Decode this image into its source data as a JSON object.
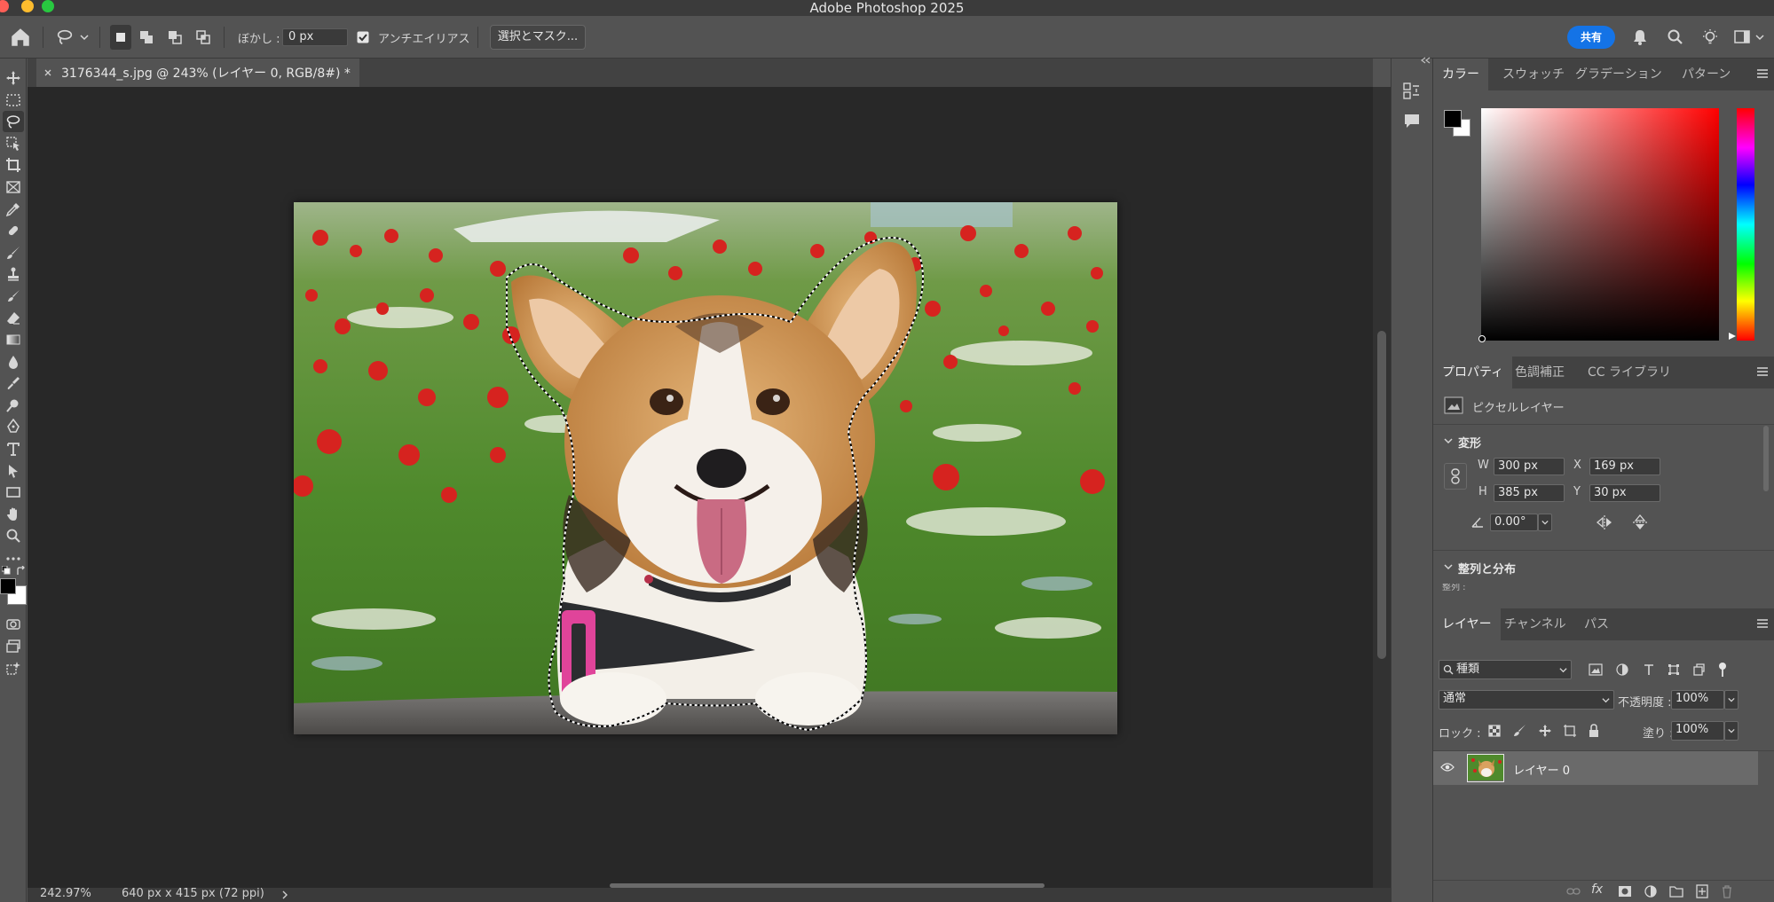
{
  "app": {
    "title": "Adobe Photoshop 2025"
  },
  "options_bar": {
    "feather_label": "ぼかし :",
    "feather_value": "0 px",
    "antialias_label": "アンチエイリアス",
    "antialias_checked": true,
    "select_mask_label": "選択とマスク...",
    "share_label": "共有"
  },
  "document": {
    "tab_title": "3176344_s.jpg @ 243% (レイヤー 0, RGB/8#) *",
    "zoom": "242.97%",
    "dimensions": "640 px x 415 px (72 ppi)"
  },
  "toolbar": {
    "tools": [
      "move-tool",
      "marquee-tool",
      "lasso-tool",
      "object-select-tool",
      "crop-tool",
      "frame-tool",
      "eyedropper-tool",
      "healing-brush-tool",
      "brush-tool",
      "clone-stamp-tool",
      "history-brush-tool",
      "eraser-tool",
      "gradient-tool",
      "blur-tool",
      "smudge-tool",
      "dodge-tool",
      "pen-tool",
      "type-tool",
      "path-select-tool",
      "rectangle-tool",
      "hand-tool",
      "zoom-tool",
      "more-tools"
    ],
    "active_tool": "lasso-tool",
    "foreground_color": "#000000",
    "background_color": "#ffffff"
  },
  "color_panel": {
    "tabs": [
      "カラー",
      "スウォッチ",
      "グラデーション",
      "パターン"
    ],
    "active_tab": "カラー",
    "hue_color": "#ff0000"
  },
  "properties_panel": {
    "tabs": [
      "プロパティ",
      "色調補正",
      "CC ライブラリ"
    ],
    "active_tab": "プロパティ",
    "layer_type": "ピクセルレイヤー",
    "transform_title": "変形",
    "w_label": "W",
    "w_value": "300 px",
    "h_label": "H",
    "h_value": "385 px",
    "x_label": "X",
    "x_value": "169 px",
    "y_label": "Y",
    "y_value": "30 px",
    "angle_value": "0.00°",
    "align_title": "整列と分布",
    "align_sub": "整列 :"
  },
  "layers_panel": {
    "tabs": [
      "レイヤー",
      "チャンネル",
      "パス"
    ],
    "active_tab": "レイヤー",
    "filter_kind": "種類",
    "blend_mode": "通常",
    "opacity_label": "不透明度 :",
    "opacity_value": "100%",
    "lock_label": "ロック :",
    "fill_label": "塗り :",
    "fill_value": "100%",
    "layers": [
      {
        "name": "レイヤー 0",
        "visible": true,
        "selected": true
      }
    ]
  },
  "colors": {
    "accent": "#1473e6",
    "panel_bg": "#535353",
    "canvas_bg": "#282828"
  }
}
